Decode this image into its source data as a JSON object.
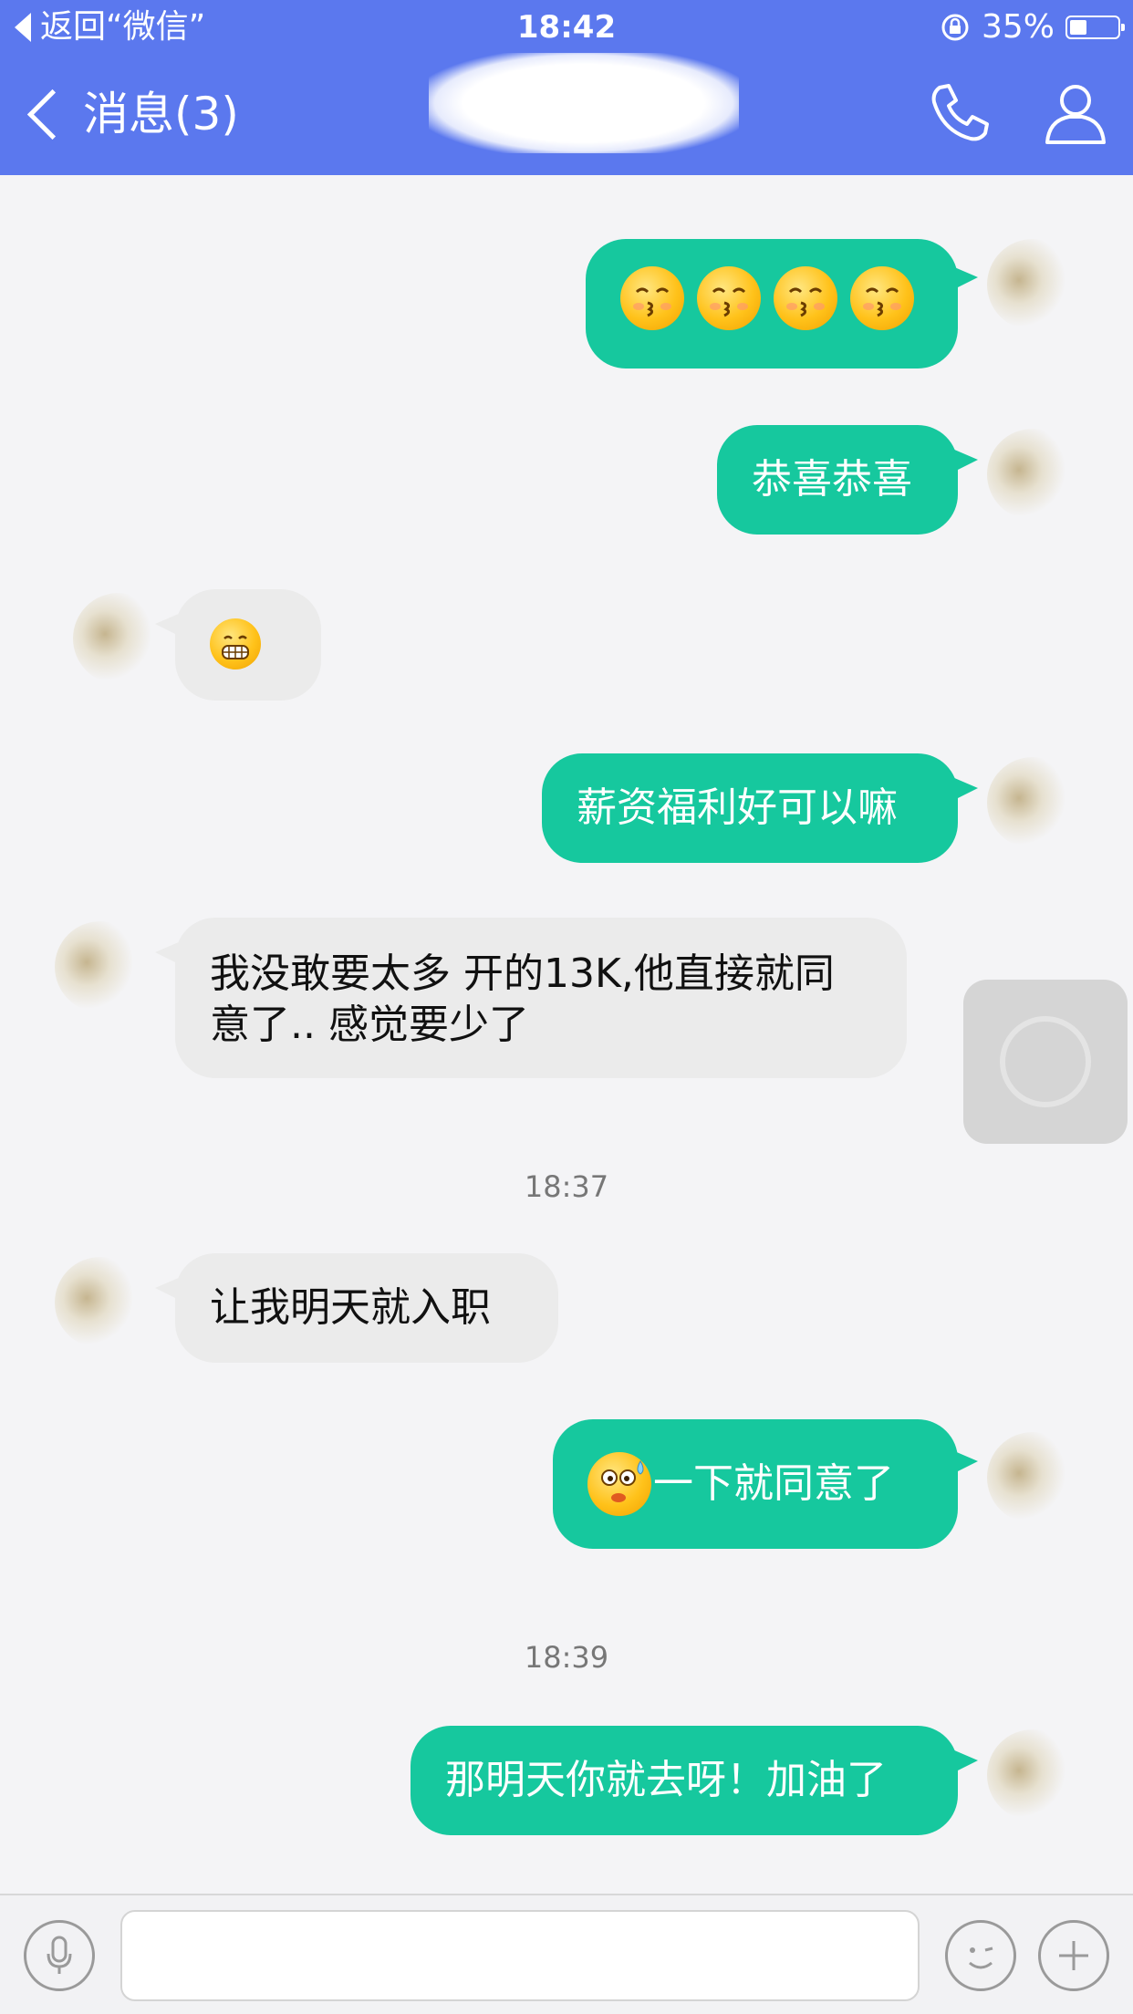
{
  "status_bar": {
    "back_label": "返回“微信”",
    "time": "18:42",
    "battery": "35%",
    "battery_level": 0.35
  },
  "nav": {
    "back_title": "消息(3)"
  },
  "messages": [
    {
      "side": "out",
      "kind": "emoji",
      "emoji": "kissing-face-icon",
      "count": 4
    },
    {
      "side": "out",
      "kind": "text",
      "text": "恭喜恭喜"
    },
    {
      "side": "in",
      "kind": "emoji",
      "emoji": "grimacing-face-icon"
    },
    {
      "side": "out",
      "kind": "text",
      "text": "薪资福利好可以嘛"
    },
    {
      "side": "in",
      "kind": "text",
      "text": "我没敢要太多 开的13K,他直接就同意了.. 感觉要少了"
    },
    {
      "side": "in",
      "kind": "text",
      "text": "让我明天就入职"
    },
    {
      "side": "out",
      "kind": "text",
      "text": "一下就同意了",
      "leading_emoji": "surprised-sweat-face-icon"
    },
    {
      "side": "out",
      "kind": "text",
      "text": "那明天你就去呀！加油了"
    }
  ],
  "timestamps": [
    "18:37",
    "18:39"
  ],
  "input_bar": {
    "placeholder": ""
  },
  "colors": {
    "header": "#5b78ee",
    "outgoing_bubble": "#16c89e",
    "incoming_bubble": "#ebebeb",
    "background": "#f4f4f6"
  }
}
